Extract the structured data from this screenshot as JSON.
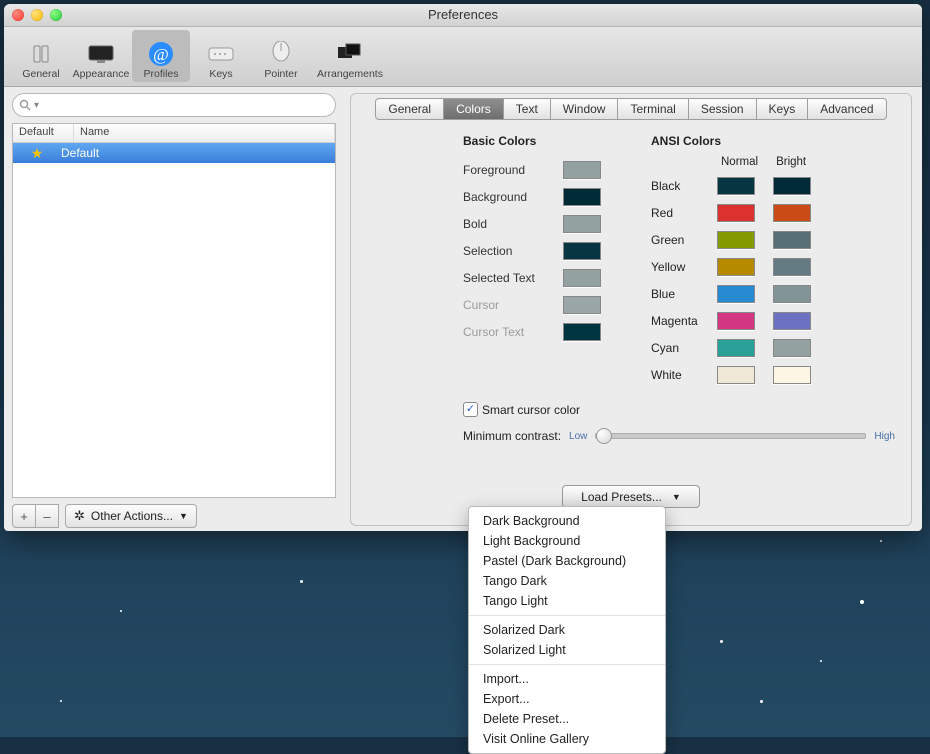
{
  "window": {
    "title": "Preferences"
  },
  "toolbar": {
    "items": [
      {
        "label": "General"
      },
      {
        "label": "Appearance"
      },
      {
        "label": "Profiles"
      },
      {
        "label": "Keys"
      },
      {
        "label": "Pointer"
      },
      {
        "label": "Arrangements"
      }
    ]
  },
  "profiles": {
    "search_placeholder": "",
    "columns": {
      "c1": "Default",
      "c2": "Name"
    },
    "rows": [
      {
        "name": "Default",
        "starred": true
      }
    ],
    "add": "+",
    "remove": "–",
    "other_actions": "Other Actions..."
  },
  "tabs": [
    "General",
    "Colors",
    "Text",
    "Window",
    "Terminal",
    "Session",
    "Keys",
    "Advanced"
  ],
  "basic": {
    "heading": "Basic Colors",
    "rows": [
      {
        "label": "Foreground",
        "color": "#93a1a1",
        "dim": false
      },
      {
        "label": "Background",
        "color": "#002b36",
        "dim": false
      },
      {
        "label": "Bold",
        "color": "#93a1a1",
        "dim": false
      },
      {
        "label": "Selection",
        "color": "#073642",
        "dim": false
      },
      {
        "label": "Selected Text",
        "color": "#93a1a1",
        "dim": false
      },
      {
        "label": "Cursor",
        "color": "#9aa6a7",
        "dim": true
      },
      {
        "label": "Cursor Text",
        "color": "#003440",
        "dim": true
      }
    ]
  },
  "ansi": {
    "heading": "ANSI Colors",
    "head_normal": "Normal",
    "head_bright": "Bright",
    "rows": [
      {
        "label": "Black",
        "normal": "#073642",
        "bright": "#002b36"
      },
      {
        "label": "Red",
        "normal": "#dc322f",
        "bright": "#cb4b16"
      },
      {
        "label": "Green",
        "normal": "#859900",
        "bright": "#586e75"
      },
      {
        "label": "Yellow",
        "normal": "#b58900",
        "bright": "#657b83"
      },
      {
        "label": "Blue",
        "normal": "#268bd2",
        "bright": "#839496"
      },
      {
        "label": "Magenta",
        "normal": "#d33682",
        "bright": "#6c71c4"
      },
      {
        "label": "Cyan",
        "normal": "#2aa198",
        "bright": "#93a1a1"
      },
      {
        "label": "White",
        "normal": "#eee8d5",
        "bright": "#fdf6e3"
      }
    ]
  },
  "smart_cursor": "Smart cursor color",
  "contrast": {
    "label": "Minimum contrast:",
    "low": "Low",
    "high": "High"
  },
  "load_presets": "Load Presets...",
  "preset_menu": {
    "group1": [
      "Dark Background",
      "Light Background",
      "Pastel (Dark Background)",
      "Tango Dark",
      "Tango Light"
    ],
    "group2": [
      "Solarized Dark",
      "Solarized Light"
    ],
    "group3": [
      "Import...",
      "Export...",
      "Delete Preset...",
      "Visit Online Gallery"
    ]
  }
}
